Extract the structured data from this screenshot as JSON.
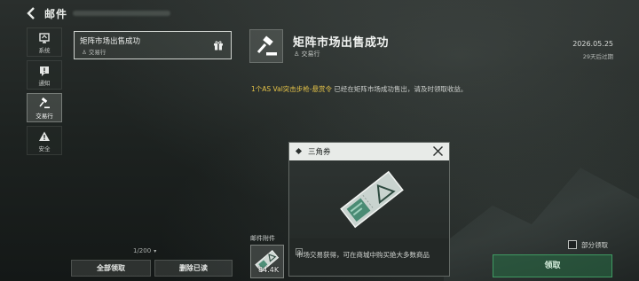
{
  "header": {
    "title": "邮件"
  },
  "nav": [
    {
      "label": "系统",
      "icon": "system-icon",
      "active": false
    },
    {
      "label": "通知",
      "icon": "notice-icon",
      "active": false
    },
    {
      "label": "交易行",
      "icon": "auction-hammer-icon",
      "active": true
    },
    {
      "label": "安全",
      "icon": "warning-icon",
      "active": false
    }
  ],
  "mail_list": {
    "items": [
      {
        "subject": "矩阵市场出售成功",
        "sender": "交易行",
        "icon": "gift-icon"
      }
    ],
    "count": "1/200",
    "claim_all_label": "全部领取",
    "delete_read_label": "删除已读"
  },
  "detail": {
    "title": "矩阵市场出售成功",
    "sender": "交易行",
    "date": "2026.05.25",
    "expire": "29天后过期",
    "body_prefix": "1个",
    "body_item": "AS Val突击步枪-悬赏令",
    "body_suffix": " 已经在矩阵市场成功售出，请及时领取收益。",
    "attachments_label": "邮件附件",
    "attachment_count": "84.4K",
    "partial_claim_label": "部分领取",
    "claim_label": "领取"
  },
  "popup": {
    "title": "三角券",
    "description": "市场交易获得，可在商城中购买绝大多数商品"
  },
  "colors": {
    "highlight": "#e4c248",
    "claim_green": "#3f9a62"
  }
}
